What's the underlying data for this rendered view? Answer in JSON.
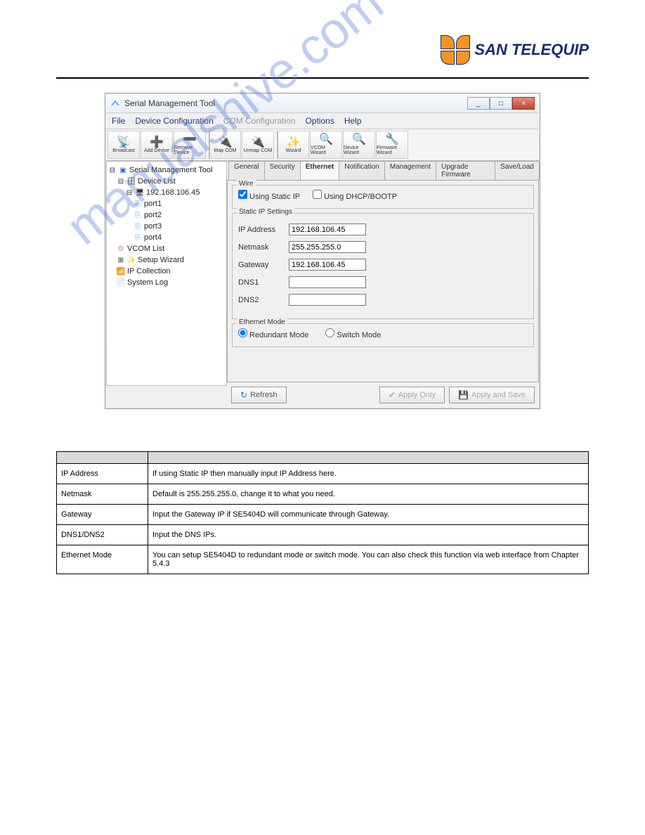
{
  "logo_text": "SAN TELEQUIP",
  "watermark": "manualshive.com",
  "window": {
    "title": "Serial Management Tool",
    "menu": [
      "File",
      "Device Configuration",
      "COM Configuration",
      "Options",
      "Help"
    ],
    "menu_disabled_index": 2,
    "toolbar": {
      "broadcast": "Broadcast",
      "add_device": "Add Device",
      "remove_device": "Remove Device",
      "map_com": "Map COM",
      "unmap_com": "Unmap COM",
      "wizard": "Wizard",
      "vcom_wizard": "VCOM Wizard",
      "device_wizard": "Device Wizard",
      "firmware_wizard": "Firmware Wizard"
    },
    "win_min": "_",
    "win_max": "□",
    "win_close": "×"
  },
  "tree": {
    "root": "Serial Management Tool",
    "device_list": "Device List",
    "device_ip": "192.168.106.45",
    "ports": [
      "port1",
      "port2",
      "port3",
      "port4"
    ],
    "vcom_list": "VCOM List",
    "setup_wizard": "Setup Wizard",
    "ip_collection": "IP Collection",
    "system_log": "System Log"
  },
  "tabs": [
    "General",
    "Security",
    "Ethernet",
    "Notification",
    "Management",
    "Upgrade Firmware",
    "Save/Load"
  ],
  "active_tab": "Ethernet",
  "wire": {
    "legend": "Wire",
    "using_static": "Using Static IP",
    "using_dhcp": "Using DHCP/BOOTP"
  },
  "static": {
    "legend": "Static IP Settings",
    "ip_label": "IP Address",
    "ip_value": "192.168.106.45",
    "netmask_label": "Netmask",
    "netmask_value": "255.255.255.0",
    "gateway_label": "Gateway",
    "gateway_value": "192.168.106.45",
    "dns1_label": "DNS1",
    "dns1_value": "",
    "dns2_label": "DNS2",
    "dns2_value": ""
  },
  "mode": {
    "legend": "Ethernet Mode",
    "redundant": "Redundant Mode",
    "switch": "Switch Mode"
  },
  "buttons": {
    "refresh": "Refresh",
    "apply_only": "Apply Only",
    "apply_save": "Apply and Save"
  },
  "doc_table": {
    "header0": "",
    "header1": "",
    "rows": [
      [
        "IP Address",
        "If using Static IP then manually input IP Address here."
      ],
      [
        "Netmask",
        "Default is 255.255.255.0, change it to what you need."
      ],
      [
        "Gateway",
        "Input the Gateway IP if SE5404D will communicate through Gateway."
      ],
      [
        "DNS1/DNS2",
        "Input the DNS IPs."
      ],
      [
        "Ethernet Mode",
        "You can setup SE5404D to redundant mode or switch mode. You can also check this function via web interface from Chapter 5.4.3"
      ]
    ]
  }
}
